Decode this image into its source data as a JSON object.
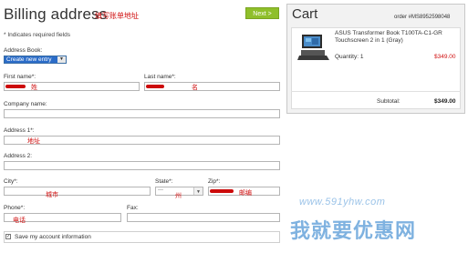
{
  "billing": {
    "title": "Billing address",
    "title_note": "填写账单地址",
    "required_note": "* Indicates required fields",
    "next_label": "Next >",
    "address_book_label": "Address Book:",
    "address_book_value": "Create new entry",
    "first_name_label": "First name*:",
    "last_name_label": "Last name*:",
    "company_label": "Company name:",
    "address1_label": "Address 1*:",
    "address2_label": "Address 2:",
    "city_label": "City*:",
    "state_label": "State*:",
    "state_value": "—",
    "zip_label": "Zip*:",
    "phone_label": "Phone*:",
    "fax_label": "Fax:",
    "save_label": "Save my account information",
    "notes": {
      "first_name": "姓",
      "last_name": "名",
      "address1": "地址",
      "city": "城市",
      "state": "州",
      "zip": "邮编",
      "phone": "电话"
    }
  },
  "cart": {
    "title": "Cart",
    "order": "order #MS8952598048",
    "product_name": "ASUS Transformer Book T100TA-C1-GR Touchscreen 2 in 1 (Gray)",
    "quantity": "Quantity: 1",
    "price": "$349.00",
    "subtotal_label": "Subtotal:",
    "subtotal_value": "$349.00"
  },
  "watermark": {
    "url": "www.591yhw.com",
    "text": "我就要优惠网"
  },
  "colors": {
    "accent_green": "#8fbf2a",
    "price_red": "#d01010",
    "select_blue": "#2b6cc8"
  }
}
